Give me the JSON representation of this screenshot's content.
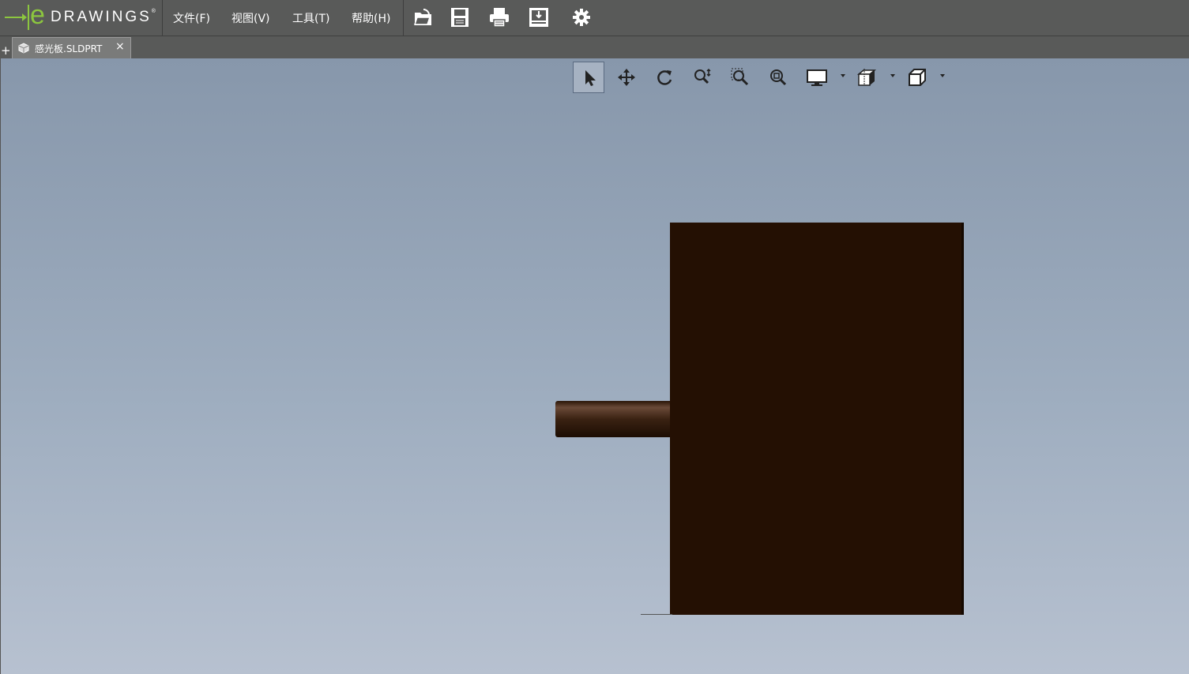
{
  "app": {
    "logo_e": "e",
    "logo_word": "DRAWINGS",
    "logo_reg": "®"
  },
  "menu": {
    "file": "文件(F)",
    "view": "视图(V)",
    "tools": "工具(T)",
    "help": "帮助(H)"
  },
  "toolbar": {
    "icons": [
      "open-icon",
      "save-icon",
      "print-icon",
      "markup-icon",
      "settings-icon"
    ]
  },
  "tabs": [
    {
      "label": "感光板.SLDPRT",
      "close": "×"
    }
  ],
  "new_tab": "+",
  "view_toolbar": {
    "tools": [
      "select-icon",
      "pan-icon",
      "rotate-icon",
      "zoom-icon",
      "zoom-to-area-icon",
      "zoom-to-fit-icon",
      "display-style-icon",
      "section-view-icon",
      "standard-views-icon"
    ],
    "active": "select-icon"
  },
  "colors": {
    "brand_green": "#8cc63f",
    "model_color": "#241003",
    "titlebar": "#595a59"
  }
}
